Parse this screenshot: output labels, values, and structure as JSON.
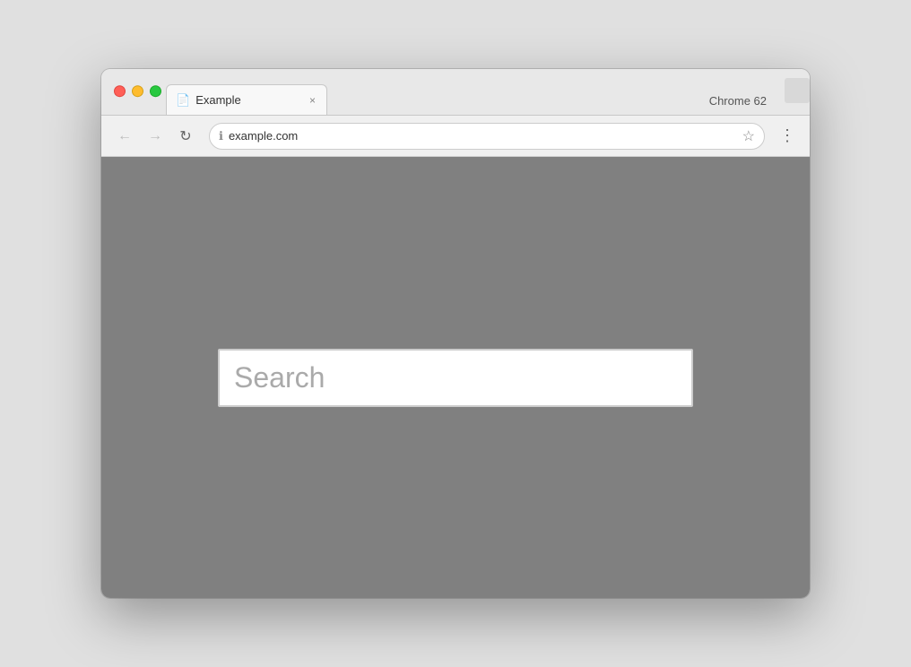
{
  "browser": {
    "chrome_version": "Chrome 62",
    "tab": {
      "title": "Example",
      "icon": "📄"
    },
    "address_bar": {
      "url": "example.com",
      "info_icon": "ℹ",
      "star_icon": "☆"
    },
    "nav": {
      "back": "←",
      "forward": "→",
      "reload": "↻",
      "menu": "⋮"
    },
    "new_tab_btn": "＋"
  },
  "page": {
    "search_placeholder": "Search"
  }
}
